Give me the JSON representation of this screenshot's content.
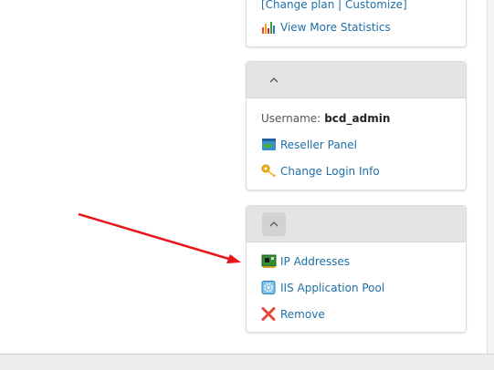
{
  "stats_panel": {
    "plan_links": "[Change plan | Customize]",
    "view_stats_label": "View More Statistics"
  },
  "account_panel": {
    "username_label": "Username:",
    "username_value": "bcd_admin",
    "reseller_panel_label": "Reseller Panel",
    "change_login_label": "Change Login Info"
  },
  "site_panel": {
    "ip_addresses_label": "IP Addresses",
    "iis_pool_label": "IIS Application Pool",
    "remove_label": "Remove"
  },
  "colors": {
    "link": "#1e6fa8",
    "annotation_arrow": "#e8161b",
    "header_bg": "#e4e4e4"
  },
  "icons": {
    "view_stats": "bar-chart-icon",
    "reseller_panel": "reseller-arrow-icon",
    "change_login": "key-icon",
    "ip_addresses": "network-card-icon",
    "iis_pool": "gear-pool-icon",
    "remove": "red-x-icon",
    "collapse": "chevron-up-icon"
  }
}
